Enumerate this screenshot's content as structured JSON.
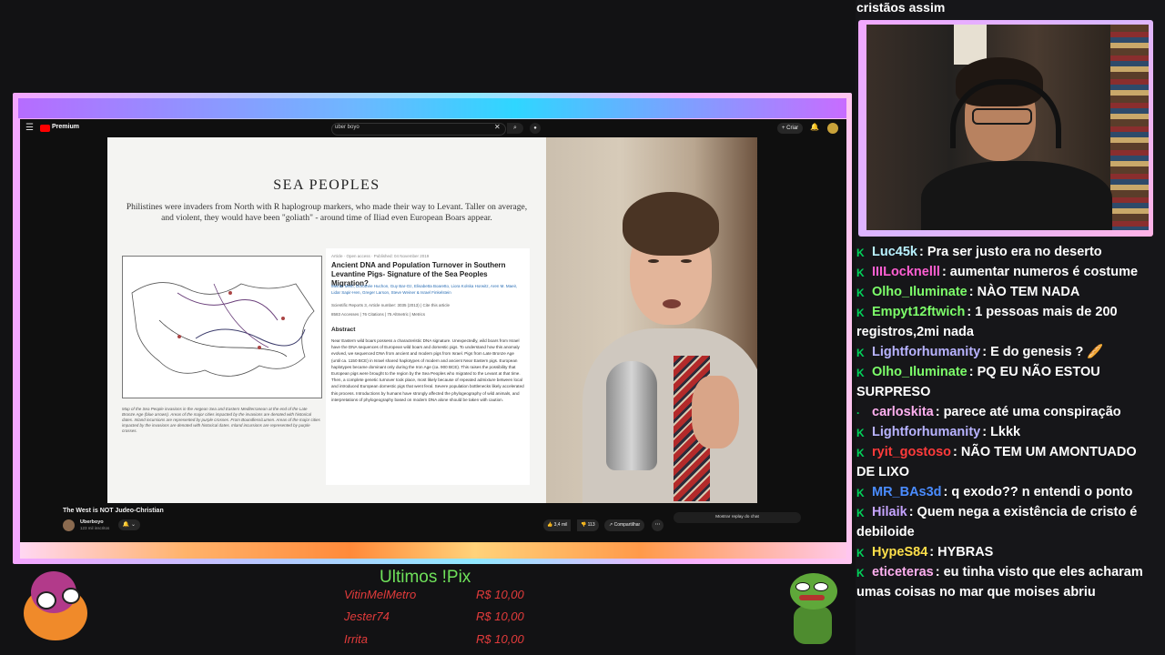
{
  "chat_top_text": "cristãos assim",
  "youtube": {
    "logo_text": "Premium",
    "search_value": "uber boyo",
    "create_label": "+ Criar",
    "video_title": "The West is NOT Judeo-Christian",
    "channel_name": "Uberboyo",
    "channel_subs": "123 mil inscritos",
    "likes": "3,4 mil",
    "dislikes": "113",
    "share_label": "Compartilhar",
    "chat_replay_label": "Mostrar replay do chat"
  },
  "slide": {
    "title": "SEA PEOPLES",
    "subtitle": "Philistines were invaders from North with R haplogroup markers, who made their way to Levant. Taller on average, and violent, they would have been \"goliath\" - around time of Iliad even European Boars appear.",
    "map_caption": "Map of the Sea People invasions in the Aegean Sea and Eastern Mediterranean at the end of the Late Bronze Age (blue arrows). Areas of the major cities impacted by the invasions are denoted with historical dates. Inland incursions are represented by purple crosses. From Boundless/Lumen. Areas of the major cities impacted by the invasions are denoted with historical dates. Inland incursions are represented by purple crosses.",
    "paper_meta": "Article · Open access · Published: 04 November 2019",
    "paper_title": "Ancient DNA and Population Turnover in Southern Levantine Pigs- Signature of the Sea Peoples Migration?",
    "paper_authors": "Meirav Meiri, Dorothée Huchon, Guy Bar-Oz, Elisabetta Boaretto, Liora Kolska Horwitz, Aren M. Maeir, Lidar Sapir-Hen, Greger Larson, Steve Weiner & Israel Finkelstein",
    "paper_journal": "Scientific Reports 3, Article number: 3035 (2013) | Cite this article",
    "paper_stats": "8583 Accesses | 76 Citations | 75 Altmetric | Metrics",
    "abstract_heading": "Abstract",
    "abstract_text": "Near Eastern wild boars possess a characteristic DNA signature. Unexpectedly, wild boars from Israel have the DNA sequences of European wild boars and domestic pigs. To understand how this anomaly evolved, we sequenced DNA from ancient and modern pigs from Israel. Pigs from Late Bronze Age (until ca. 1150 BCE) in Israel shared haplotypes of modern and ancient Near Eastern pigs. European haplotypes became dominant only during the Iron Age (ca. 900 BCE). This raises the possibility that European pigs were brought to the region by the Sea Peoples who migrated to the Levant at that time. Then, a complete genetic turnover took place, most likely because of repeated admixture between local and introduced European domestic pigs that went feral. Severe population bottlenecks likely accelerated this process. Introductions by humans have strongly affected the phylogeography of wild animals, and interpretations of phylogeography based on modern DNA alone should be taken with caution."
  },
  "chat": [
    {
      "user": "Luc45k",
      "color": "#b9f2ff",
      "badge": "K",
      "text": ": Pra ser justo era no deserto"
    },
    {
      "user": "IIILocknelll",
      "color": "#ff5fd2",
      "badge": "K",
      "text": ": aumentar numeros é costume"
    },
    {
      "user": "Olho_Iluminate",
      "color": "#7dff6a",
      "badge": "K",
      "text": ": NÀO TEM NADA"
    },
    {
      "user": "Empyt12ftwich",
      "color": "#7dff6a",
      "badge": "K",
      "text": ": 1 pessoas mais de 200 registros,2mi nada"
    },
    {
      "user": "Lightforhumanity",
      "color": "#b8b3ff",
      "badge": "K",
      "text": ": E do genesis ? 🥖"
    },
    {
      "user": "Olho_Iluminate",
      "color": "#7dff6a",
      "badge": "K",
      "text": ": PQ EU NÃO ESTOU SURPRESO"
    },
    {
      "user": "carloskita",
      "color": "#ffb0f0",
      "badge": "·",
      "text": ": parece até uma conspiração"
    },
    {
      "user": "Lightforhumanity",
      "color": "#b8b3ff",
      "badge": "K",
      "text": ": Lkkk"
    },
    {
      "user": "ryit_gostoso",
      "color": "#ff3b3b",
      "badge": "K",
      "text": ": NÃO TEM UM AMONTUADO DE LIXO"
    },
    {
      "user": "MR_BAs3d",
      "color": "#4a8cff",
      "badge": "K",
      "text": ": q exodo?? n entendi o ponto"
    },
    {
      "user": "Hilaik",
      "color": "#c6a4ff",
      "badge": "K",
      "text": ": Quem nega a existência de cristo é debiloide"
    },
    {
      "user": "HypeS84",
      "color": "#ffe04a",
      "badge": "K",
      "text": ": HYBRAS"
    },
    {
      "user": "eticeteras",
      "color": "#ffb0f0",
      "badge": "K",
      "text": ": eu tinha visto que eles acharam umas coisas no mar que moises abriu"
    }
  ],
  "pix": {
    "title": "Ultimos !Pix",
    "rows": [
      {
        "name": "VitinMelMetro",
        "amount": "R$ 10,00"
      },
      {
        "name": "Jester74",
        "amount": "R$ 10,00"
      },
      {
        "name": "Irrita",
        "amount": "R$ 10,00"
      }
    ]
  }
}
